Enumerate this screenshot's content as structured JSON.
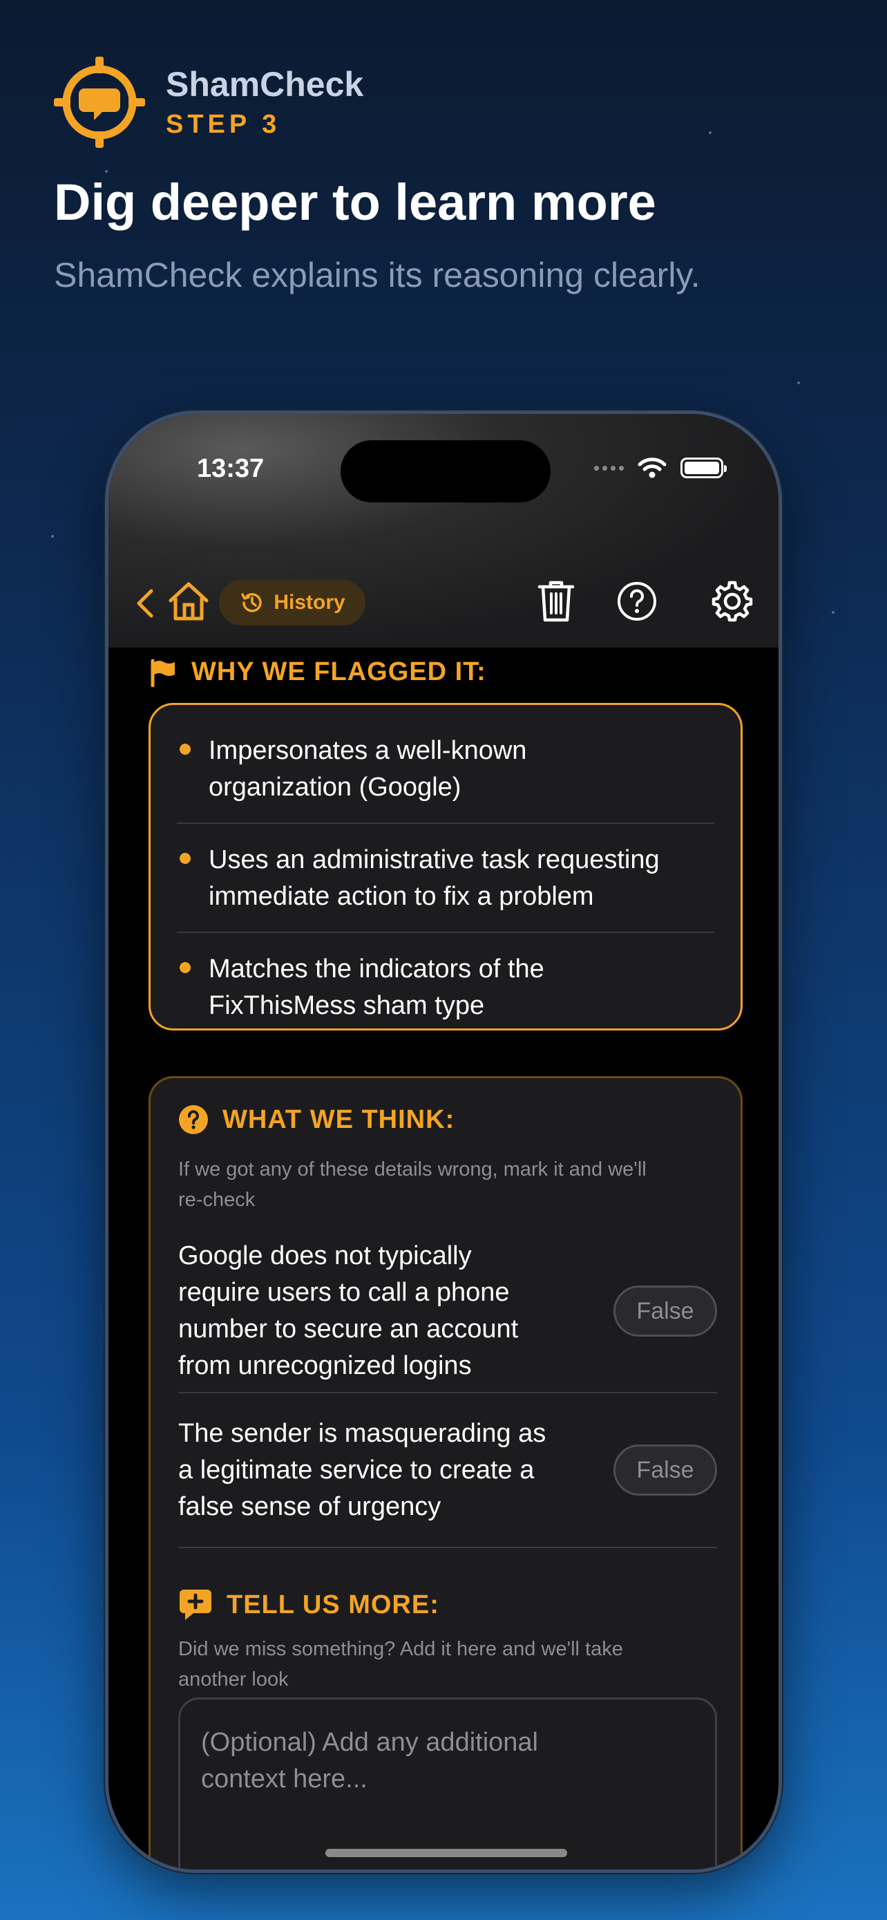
{
  "brand": {
    "name": "ShamCheck",
    "step": "STEP 3"
  },
  "headline": "Dig deeper to learn more",
  "subline": "ShamCheck explains its reasoning clearly.",
  "status": {
    "time": "13:37"
  },
  "nav": {
    "history_label": "History"
  },
  "flagged": {
    "title": "WHY WE FLAGGED IT:",
    "items": [
      {
        "line1": "Impersonates a well-known",
        "line2": "organization (Google)"
      },
      {
        "line1": "Uses an administrative task requesting",
        "line2": "immediate action to fix a problem"
      },
      {
        "line1": "Matches the indicators of the",
        "line2": "FixThisMess sham type"
      }
    ]
  },
  "think": {
    "title": "WHAT WE THINK:",
    "hint_line1": "If we got any of these details wrong, mark it and we'll",
    "hint_line2": "re-check",
    "claims": [
      {
        "lines": [
          "Google does not typically",
          "require users to call a phone",
          "number to secure an account",
          "from unrecognized logins"
        ],
        "button": "False"
      },
      {
        "lines": [
          "The sender is masquerading as",
          "a legitimate service to create a",
          "false sense of urgency"
        ],
        "button": "False"
      }
    ]
  },
  "more": {
    "title": "TELL US MORE:",
    "hint_line1": "Did we miss something? Add it here and we'll take",
    "hint_line2": "another look",
    "placeholder_line1": "(Optional) Add any additional",
    "placeholder_line2": "context here..."
  },
  "colors": {
    "accent": "#f4a425",
    "card": "#1c1c1e",
    "bg_top": "#0c1a30",
    "bg_bottom": "#1a72bf"
  },
  "icons": [
    "target-chat-logo-icon",
    "chevron-left-icon",
    "home-icon",
    "history-icon",
    "trash-icon",
    "help-icon",
    "gear-icon",
    "flag-icon",
    "question-circle-icon",
    "chat-plus-icon",
    "wifi-icon",
    "battery-icon"
  ]
}
